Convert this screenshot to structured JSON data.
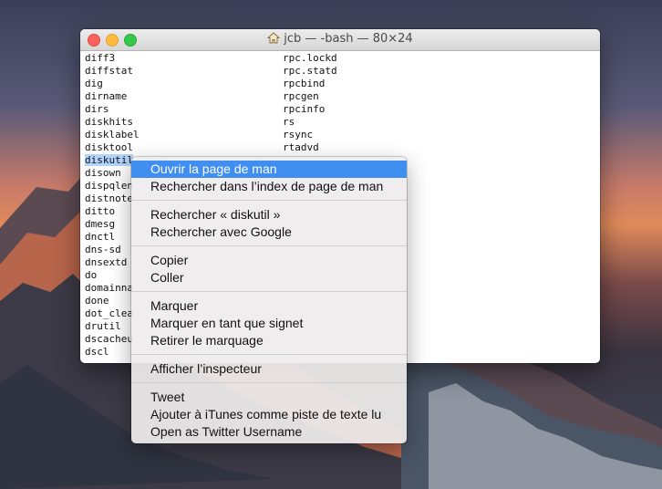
{
  "window": {
    "title": "jcb — -bash — 80×24",
    "icon": "home-icon"
  },
  "terminal": {
    "col1": [
      "diff3",
      "diffstat",
      "dig",
      "dirname",
      "dirs",
      "diskhits",
      "disklabel",
      "disktool",
      "diskutil",
      "disown",
      "dispqlen",
      "distnote",
      "ditto",
      "dmesg",
      "dnctl",
      "dns-sd",
      "dnsextd",
      "do",
      "domainna",
      "done",
      "dot_clea",
      "drutil",
      "dscacheu",
      "dscl"
    ],
    "col2": [
      "rpc.lockd",
      "rpc.statd",
      "rpcbind",
      "rpcgen",
      "rpcinfo",
      "rs",
      "rsync",
      "rtadvd"
    ],
    "selected": "diskutil"
  },
  "menu": {
    "groups": [
      [
        "Ouvrir la page de man",
        "Rechercher dans l’index de page de man"
      ],
      [
        "Rechercher « diskutil »",
        "Rechercher avec Google"
      ],
      [
        "Copier",
        "Coller"
      ],
      [
        "Marquer",
        "Marquer en tant que signet",
        "Retirer le marquage"
      ],
      [
        "Afficher l’inspecteur"
      ],
      [
        "Tweet",
        "Ajouter à iTunes comme piste de texte lu",
        "Open as Twitter Username"
      ]
    ],
    "highlighted": "Ouvrir la page de man",
    "highlight_color": "#3f8ef0"
  }
}
